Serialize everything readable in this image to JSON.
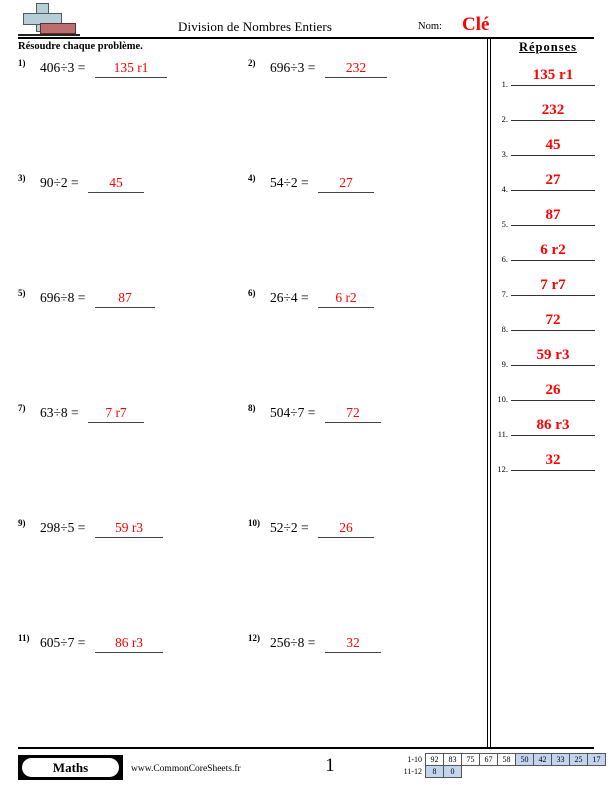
{
  "header": {
    "title": "Division de Nombres Entiers",
    "name_label": "Nom:",
    "name_value": "Clé",
    "logo_icon": "plus-bar-logo-icon"
  },
  "instruction": "Résoudre chaque problème.",
  "answers_heading": "Réponses",
  "problems": [
    {
      "number": "1)",
      "expression": "406÷3 =",
      "answer": "135 r1"
    },
    {
      "number": "2)",
      "expression": "696÷3 =",
      "answer": "232"
    },
    {
      "number": "3)",
      "expression": "90÷2 =",
      "answer": "45"
    },
    {
      "number": "4)",
      "expression": "54÷2 =",
      "answer": "27"
    },
    {
      "number": "5)",
      "expression": "696÷8 =",
      "answer": "87"
    },
    {
      "number": "6)",
      "expression": "26÷4 =",
      "answer": "6 r2"
    },
    {
      "number": "7)",
      "expression": "63÷8 =",
      "answer": "7 r7"
    },
    {
      "number": "8)",
      "expression": "504÷7 =",
      "answer": "72"
    },
    {
      "number": "9)",
      "expression": "298÷5 =",
      "answer": "59 r3"
    },
    {
      "number": "10)",
      "expression": "52÷2 =",
      "answer": "26"
    },
    {
      "number": "11)",
      "expression": "605÷7 =",
      "answer": "86 r3"
    },
    {
      "number": "12)",
      "expression": "256÷8 =",
      "answer": "32"
    }
  ],
  "answer_key": [
    {
      "index": "1.",
      "value": "135 r1"
    },
    {
      "index": "2.",
      "value": "232"
    },
    {
      "index": "3.",
      "value": "45"
    },
    {
      "index": "4.",
      "value": "27"
    },
    {
      "index": "5.",
      "value": "87"
    },
    {
      "index": "6.",
      "value": "6 r2"
    },
    {
      "index": "7.",
      "value": "7 r7"
    },
    {
      "index": "8.",
      "value": "72"
    },
    {
      "index": "9.",
      "value": "59 r3"
    },
    {
      "index": "10.",
      "value": "26"
    },
    {
      "index": "11.",
      "value": "86 r3"
    },
    {
      "index": "12.",
      "value": "32"
    }
  ],
  "footer": {
    "brand": "Maths",
    "site": "www.CommonCoreSheets.fr",
    "page_number": "1",
    "score_grid": {
      "row1_label": "1-10",
      "row2_label": "11-12",
      "row1": [
        {
          "value": "92",
          "shaded": false
        },
        {
          "value": "83",
          "shaded": false
        },
        {
          "value": "75",
          "shaded": false
        },
        {
          "value": "67",
          "shaded": false
        },
        {
          "value": "58",
          "shaded": false
        },
        {
          "value": "50",
          "shaded": true
        },
        {
          "value": "42",
          "shaded": true
        },
        {
          "value": "33",
          "shaded": true
        },
        {
          "value": "25",
          "shaded": true
        },
        {
          "value": "17",
          "shaded": true
        }
      ],
      "row2": [
        {
          "value": "8",
          "shaded": true
        },
        {
          "value": "0",
          "shaded": true
        }
      ]
    }
  },
  "colors": {
    "answer_red": "#ff0000",
    "grid_shaded": "#c3d4ee",
    "logo_blue": "#b6ced6",
    "logo_red": "#bc6e6e"
  }
}
